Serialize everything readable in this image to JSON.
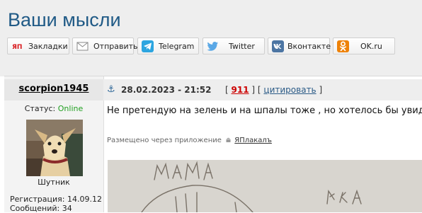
{
  "page": {
    "title": "Ваши мысли"
  },
  "share": [
    {
      "label": "Закладки",
      "icon": "yap-bookmark-icon",
      "color": "#d8181c"
    },
    {
      "label": "Отправить",
      "icon": "envelope-icon",
      "color": "#777777"
    },
    {
      "label": "Telegram",
      "icon": "telegram-icon",
      "color": "#2ca5e0"
    },
    {
      "label": "Twitter",
      "icon": "twitter-icon",
      "color": "#5aa8e6"
    },
    {
      "label": "Вконтакте",
      "icon": "vk-icon",
      "color": "#4c75a3"
    },
    {
      "label": "OK.ru",
      "icon": "ok-icon",
      "color": "#ee8208"
    }
  ],
  "author": {
    "username": "scorpion1945",
    "status_label": "Статус:",
    "status_value": "Online",
    "avatar_caption": "Шутник",
    "registration": "Регистрация: 14.09.12",
    "messages": "Сообщений: 34"
  },
  "post": {
    "anchor_icon": "anchor-icon",
    "date": "28.02.2023 - 21:52",
    "rating_open": "[",
    "rating_value": "911",
    "rating_mid": "] [",
    "quote_label": "цитировать",
    "quote_close": "]",
    "text": "Не претендую на зелень и на шпалы тоже , но хотелось бы увидеть",
    "via_prefix": "Размещено через приложение",
    "via_app": "ЯПлакалъ",
    "image_alt": "photo-of-child-drawing"
  },
  "colors": {
    "title": "#205a86",
    "online": "#22a022",
    "rating": "#cc0000",
    "link": "#2a5a86"
  }
}
